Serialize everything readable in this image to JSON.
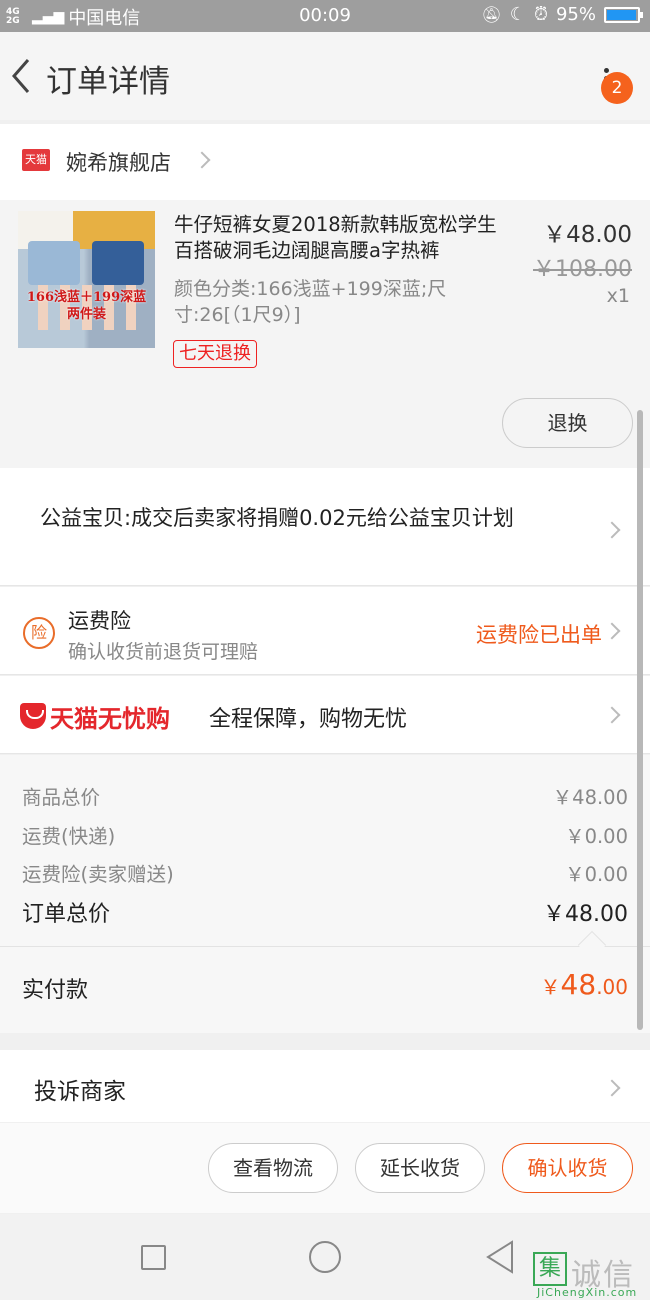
{
  "status_bar": {
    "network": "4G 2G",
    "carrier": "中国电信",
    "time": "00:09",
    "battery": "95%",
    "battery_level": 0.95
  },
  "header": {
    "title": "订单详情",
    "badge_count": "2"
  },
  "store": {
    "tag": "天猫",
    "name": "婉希旗舰店"
  },
  "product": {
    "image_text_line1": "166浅蓝＋199深蓝",
    "image_text_line2": "两件装",
    "title": "牛仔短裤女夏2018新款韩版宽松学生百搭破洞毛边阔腿高腰a字热裤",
    "attributes": "颜色分类:166浅蓝+199深蓝;尺寸:26[（1尺9）]",
    "price": "￥48.00",
    "original_price": "￥108.00",
    "quantity": "x1",
    "return_badge": "七天退换",
    "return_button": "退换"
  },
  "charity": {
    "text": "公益宝贝:成交后卖家将捐赠0.02元给公益宝贝计划"
  },
  "insurance": {
    "icon": "险",
    "title": "运费险",
    "subtitle": "确认收货前退货可理赔",
    "status": "运费险已出单"
  },
  "worry_free": {
    "brand": "天猫无忧购",
    "text": "全程保障，购物无忧"
  },
  "summary": {
    "rows": [
      {
        "label": "商品总价",
        "value": "￥48.00"
      },
      {
        "label": "运费(快递)",
        "value": "￥0.00"
      },
      {
        "label": "运费险(卖家赠送)",
        "value": "￥0.00"
      }
    ],
    "total_label": "订单总价",
    "total_value": "￥48.00",
    "paid_label": "实付款",
    "paid_currency": "￥",
    "paid_int": "48",
    "paid_dec": ".00"
  },
  "complaint": {
    "label": "投诉商家"
  },
  "actions": {
    "logistics": "查看物流",
    "extend": "延长收货",
    "confirm": "确认收货"
  },
  "watermark": {
    "box_char": "集",
    "text": "诚信",
    "url": "JiChengXin.com"
  },
  "colors": {
    "accent": "#ef5a1c",
    "tmall_red": "#e4272c",
    "status_bar": "#9e9e9e"
  }
}
